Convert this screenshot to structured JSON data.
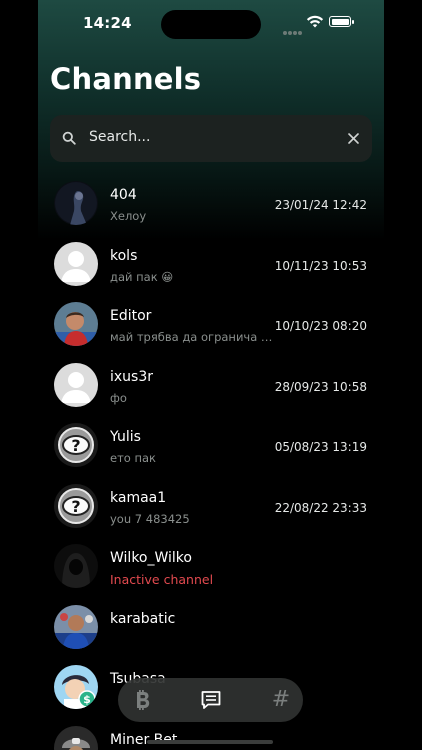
{
  "status": {
    "time": "14:24"
  },
  "page": {
    "title": "Channels"
  },
  "search": {
    "placeholder": "Search..."
  },
  "channels": [
    {
      "name": "404",
      "message": "Хелоу",
      "date": "23/01/24 12:42",
      "avatar": "photo-dark"
    },
    {
      "name": "kols",
      "message": "дай пак 😀",
      "date": "10/11/23 10:53",
      "avatar": "default-person"
    },
    {
      "name": "Editor",
      "message": "май трябва да огранича вис...",
      "date": "10/10/23 08:20",
      "avatar": "photo-footballer"
    },
    {
      "name": "ixus3r",
      "message": "фо",
      "date": "28/09/23 10:58",
      "avatar": "default-person"
    },
    {
      "name": "Yulis",
      "message": "ето пак",
      "date": "05/08/23 13:19",
      "avatar": "question-face"
    },
    {
      "name": "kamaa1",
      "message": "you 7 483425",
      "date": "22/08/22 23:33",
      "avatar": "question-face"
    },
    {
      "name": "Wilko_Wilko",
      "message": "Inactive channel",
      "date": "",
      "avatar": "hooded-figure",
      "inactive": true
    },
    {
      "name": "karabatic",
      "message": "",
      "date": "",
      "avatar": "photo-handball"
    },
    {
      "name": "Tsubasa",
      "message": "",
      "date": "",
      "avatar": "anime-with-dollar-badge"
    },
    {
      "name": "Miner Bet",
      "message": "",
      "date": "",
      "avatar": "miner-helmet"
    }
  ],
  "tabs": [
    {
      "icon": "bitcoin-icon"
    },
    {
      "icon": "chat-icon"
    },
    {
      "icon": "hashtag-icon",
      "label": "#"
    }
  ],
  "colors": {
    "accent_inactive": "#e24a4f",
    "background_top": "#1e4a42",
    "search_bg": "#1c2220"
  }
}
